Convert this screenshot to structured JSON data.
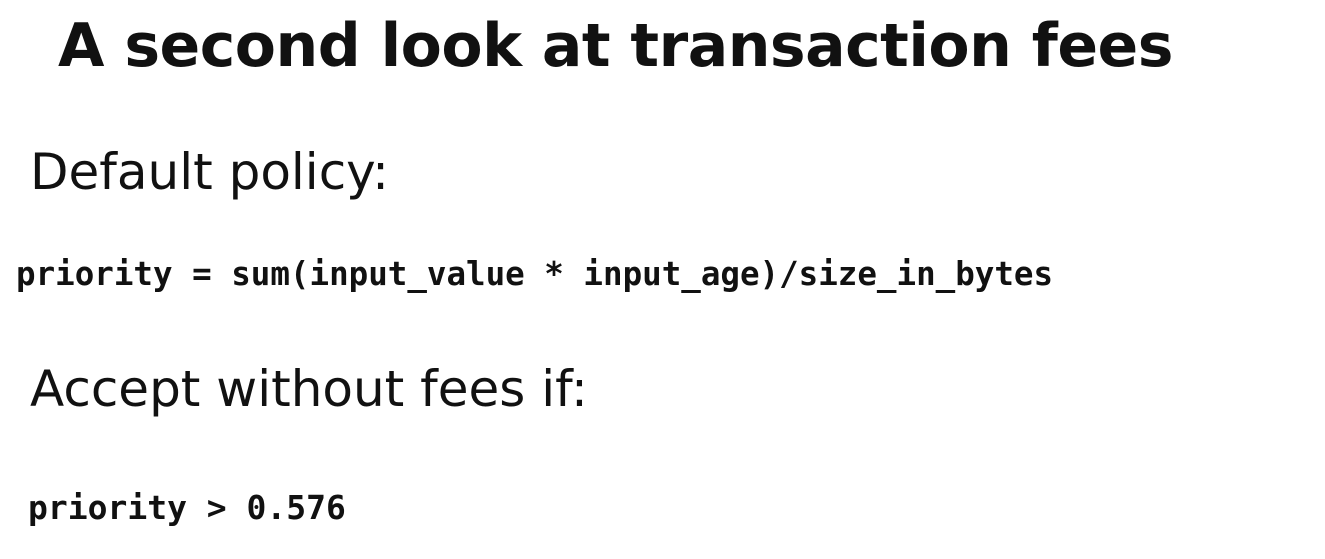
{
  "slide": {
    "title": "A second look at transaction fees",
    "section1_heading": "Default policy:",
    "formula": "priority = sum(input_value * input_age)/size_in_bytes",
    "section2_heading": "Accept without fees if:",
    "condition": "priority > 0.576"
  },
  "colors": {
    "background": "#ffffff",
    "text": "#111111"
  }
}
